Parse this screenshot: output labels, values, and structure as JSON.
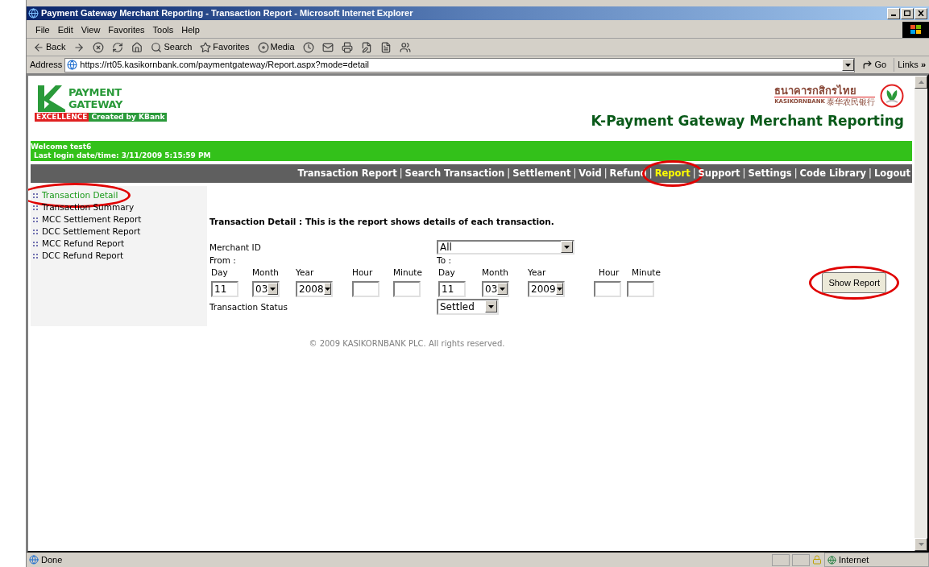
{
  "window": {
    "title": "Payment Gateway Merchant Reporting - Transaction Report - Microsoft Internet Explorer"
  },
  "menu": [
    "File",
    "Edit",
    "View",
    "Favorites",
    "Tools",
    "Help"
  ],
  "toolbar": [
    {
      "kind": "back",
      "label": "Back"
    },
    {
      "kind": "forward"
    },
    {
      "kind": "stop"
    },
    {
      "kind": "refresh"
    },
    {
      "kind": "home"
    },
    {
      "kind": "search",
      "label": "Search"
    },
    {
      "kind": "favorites",
      "label": "Favorites"
    },
    {
      "kind": "media",
      "label": "Media"
    },
    {
      "kind": "history"
    },
    {
      "kind": "mail"
    },
    {
      "kind": "print"
    },
    {
      "kind": "edit"
    },
    {
      "kind": "discuss"
    },
    {
      "kind": "messenger"
    }
  ],
  "address_bar": {
    "label": "Address",
    "url": "https://rt05.kasikornbank.com/paymentgateway/Report.aspx?mode=detail",
    "go": "Go",
    "links": "Links",
    "more": "»"
  },
  "header": {
    "logo": {
      "line1": "PAYMENT",
      "line2": "GATEWAY",
      "tag1": "EXCELLENCE",
      "tag2": "Created by KBank"
    },
    "bank_thai": "ธนาคารกสิกรไทย",
    "bank_en": "KASIKORNBANK",
    "bank_cn": "泰华农民银行",
    "title": "K-Payment Gateway Merchant Reporting"
  },
  "welcome": {
    "line1": "Welcome test6",
    "line2": "Last login date/time: 3/11/2009 5:15:59 PM"
  },
  "nav": [
    {
      "kind": "link",
      "label": "Transaction Report",
      "selected": false,
      "circled": false
    },
    {
      "kind": "separator",
      "label": "|"
    },
    {
      "kind": "link",
      "label": "Search Transaction",
      "selected": false,
      "circled": false
    },
    {
      "kind": "separator",
      "label": "|"
    },
    {
      "kind": "link",
      "label": "Settlement",
      "selected": false,
      "circled": false
    },
    {
      "kind": "separator",
      "label": "|"
    },
    {
      "kind": "link",
      "label": "Void",
      "selected": false,
      "circled": false
    },
    {
      "kind": "separator",
      "label": "|"
    },
    {
      "kind": "link",
      "label": "Refund",
      "selected": false,
      "circled": false
    },
    {
      "kind": "separator",
      "label": "|"
    },
    {
      "kind": "link",
      "label": "Report",
      "selected": true,
      "circled": true
    },
    {
      "kind": "separator",
      "label": "|"
    },
    {
      "kind": "link",
      "label": "Support",
      "selected": false,
      "circled": false
    },
    {
      "kind": "separator",
      "label": "|"
    },
    {
      "kind": "link",
      "label": "Settings",
      "selected": false,
      "circled": false
    },
    {
      "kind": "separator",
      "label": "|"
    },
    {
      "kind": "link",
      "label": "Code Library",
      "selected": false,
      "circled": false
    },
    {
      "kind": "separator",
      "label": "|"
    },
    {
      "kind": "link",
      "label": "Logout",
      "selected": false,
      "circled": false
    }
  ],
  "sidebar": {
    "items": [
      {
        "label": "Transaction Detail",
        "selected": true,
        "circled": true
      },
      {
        "label": "Transaction Summary",
        "selected": false,
        "circled": false
      },
      {
        "label": "MCC Settlement Report",
        "selected": false,
        "circled": false
      },
      {
        "label": "DCC Settlement Report",
        "selected": false,
        "circled": false
      },
      {
        "label": "MCC Refund Report",
        "selected": false,
        "circled": false
      },
      {
        "label": "DCC Refund Report",
        "selected": false,
        "circled": false
      }
    ]
  },
  "form": {
    "heading": "Transaction Detail : This is the report shows details of each transaction.",
    "merchant": {
      "label": "Merchant ID",
      "value": "All"
    },
    "from": {
      "label": "From :",
      "fields": [
        {
          "kind": "text",
          "label": "Day",
          "value": "11"
        },
        {
          "kind": "select",
          "label": "Month",
          "value": "03"
        },
        {
          "kind": "select",
          "label": "Year",
          "value": "2008"
        },
        {
          "kind": "text",
          "label": "Hour"
        },
        {
          "kind": "text",
          "label": "Minute"
        }
      ]
    },
    "to": {
      "label": "To :",
      "fields": [
        {
          "kind": "text",
          "label": "Day",
          "value": "11"
        },
        {
          "kind": "select",
          "label": "Month",
          "value": "03"
        },
        {
          "kind": "select",
          "label": "Year",
          "value": "2009"
        },
        {
          "kind": "text",
          "label": "Hour"
        },
        {
          "kind": "text",
          "label": "Minute"
        }
      ]
    },
    "status": {
      "label": "Transaction Status",
      "value": "Settled"
    },
    "submit": {
      "label": "Show Report",
      "circled": true
    }
  },
  "footer": "© 2009 KASIKORNBANK PLC. All rights reserved.",
  "status_bar": {
    "text": "Done",
    "zone": "Internet"
  }
}
